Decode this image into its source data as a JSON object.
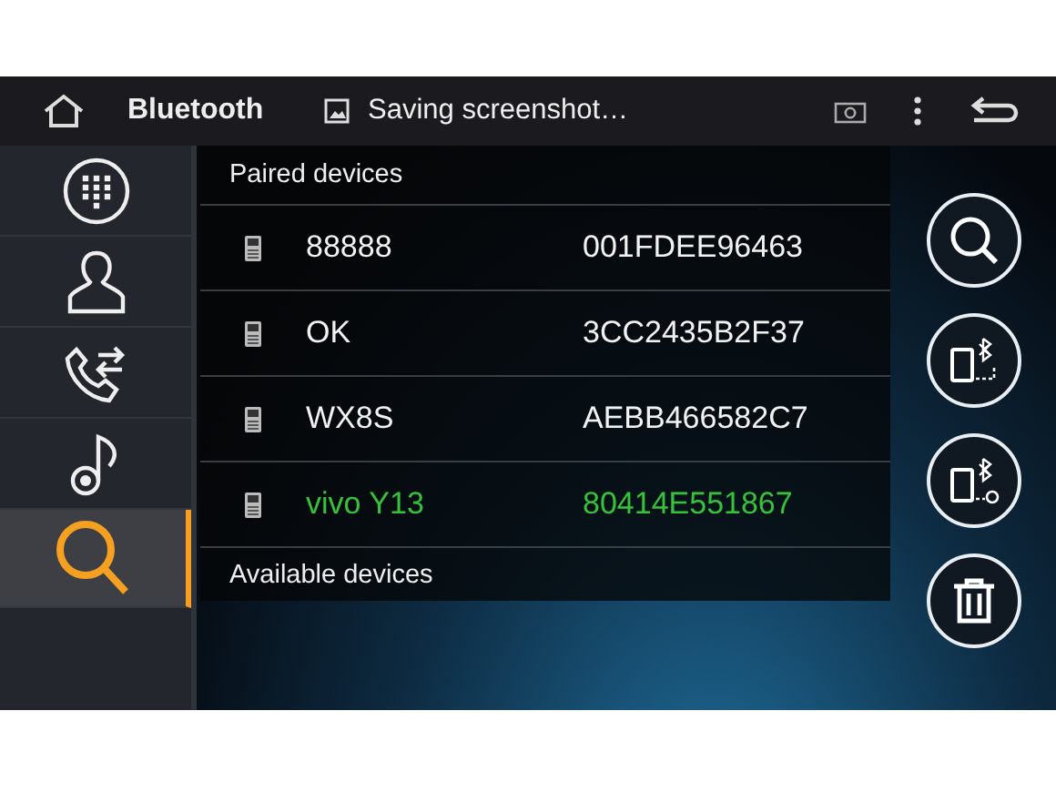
{
  "top_bar": {
    "title": "Bluetooth",
    "notification": "Saving screenshot…"
  },
  "sidebar": {
    "items": [
      {
        "kind": "dialpad",
        "selected": false
      },
      {
        "kind": "contacts",
        "selected": false
      },
      {
        "kind": "calls",
        "selected": false
      },
      {
        "kind": "music",
        "selected": false
      },
      {
        "kind": "search",
        "selected": true
      }
    ]
  },
  "paired_devices": {
    "heading": "Paired devices",
    "devices": [
      {
        "name": "88888",
        "address": "001FDEE96463",
        "connected": false
      },
      {
        "name": "OK",
        "address": "3CC2435B2F37",
        "connected": false
      },
      {
        "name": "WX8S",
        "address": "AEBB466582C7",
        "connected": false
      },
      {
        "name": "vivo Y13",
        "address": "80414E551867",
        "connected": true
      }
    ]
  },
  "available_devices": {
    "heading": "Available devices"
  },
  "actions": [
    {
      "kind": "search"
    },
    {
      "kind": "connect"
    },
    {
      "kind": "disconnect"
    },
    {
      "kind": "delete"
    }
  ]
}
